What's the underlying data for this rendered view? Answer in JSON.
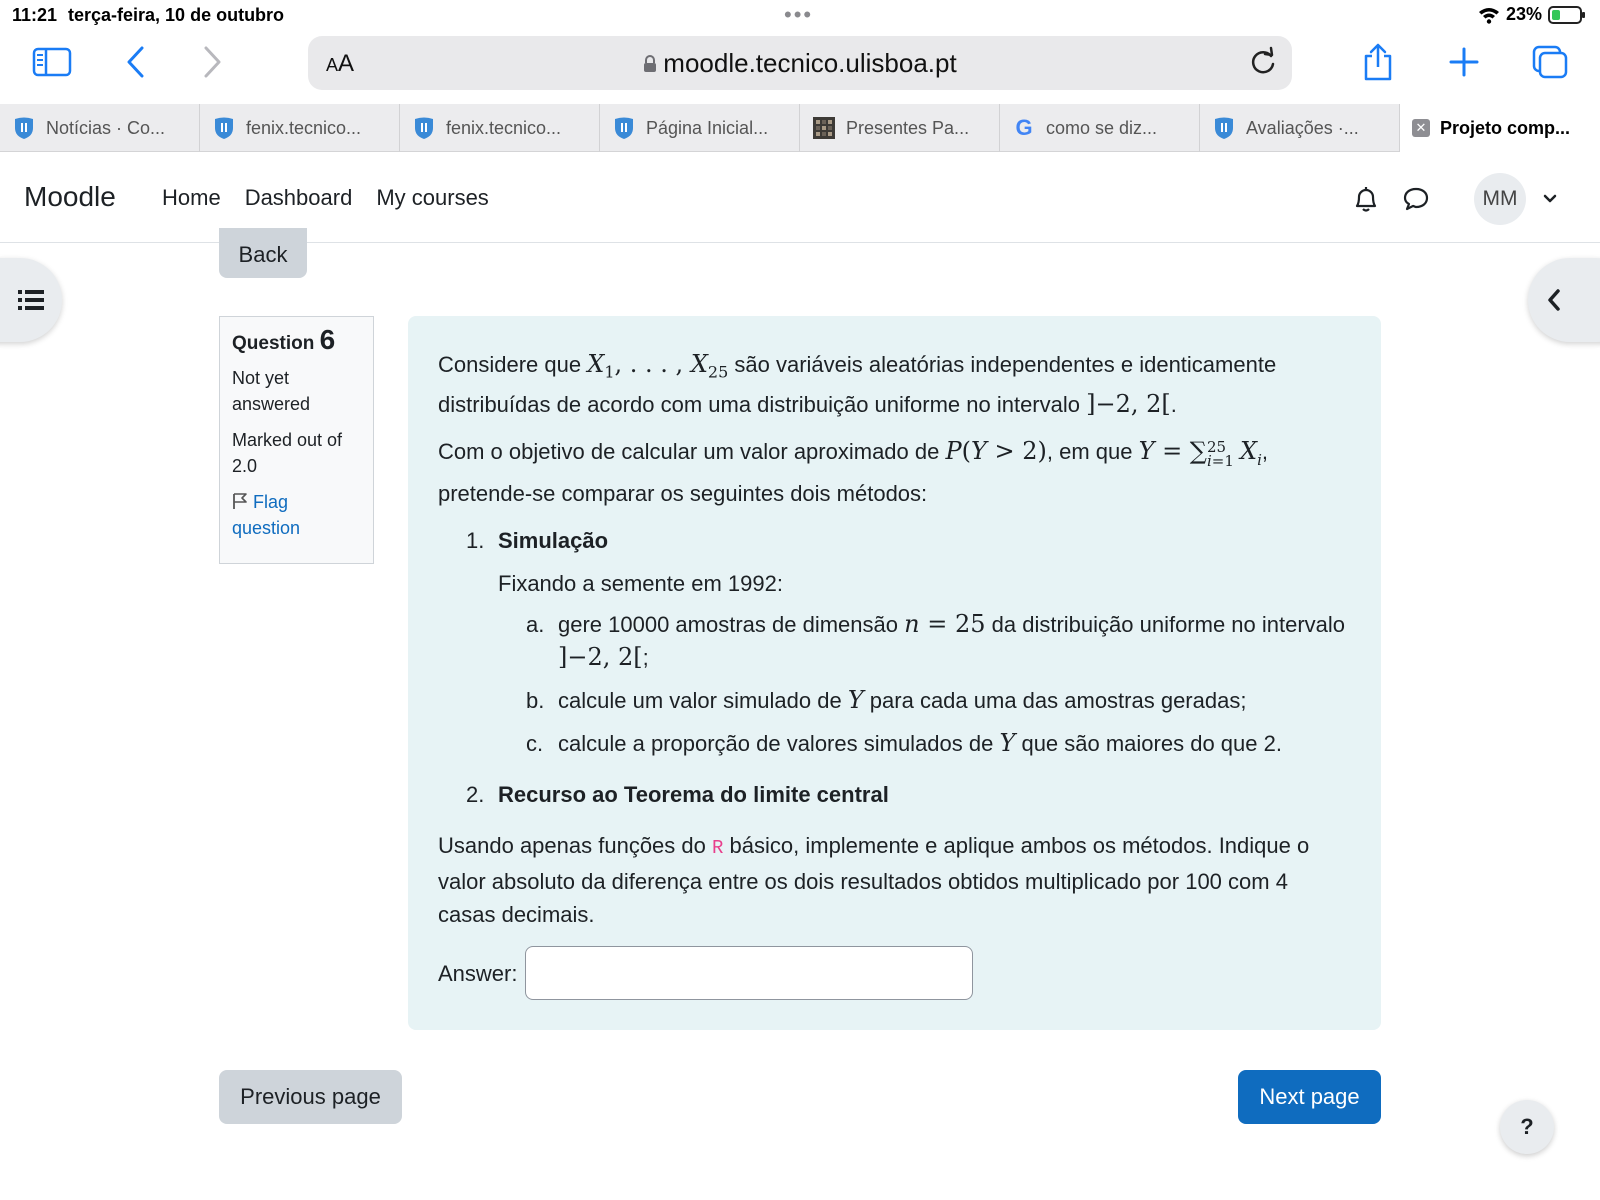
{
  "status_bar": {
    "time": "11:21",
    "date": "terça-feira, 10 de outubro",
    "battery_percent": "23%"
  },
  "browser": {
    "reader_label_small": "A",
    "reader_label_big": "A",
    "url": "moodle.tecnico.ulisboa.pt",
    "tabs": [
      {
        "label": "Notícias · Co...",
        "icon": "ist-shield-icon"
      },
      {
        "label": "fenix.tecnico...",
        "icon": "ist-shield-icon"
      },
      {
        "label": "fenix.tecnico...",
        "icon": "ist-shield-icon"
      },
      {
        "label": "Página Inicial...",
        "icon": "ist-shield-icon"
      },
      {
        "label": "Presentes Pa...",
        "icon": "grid-favicon-icon"
      },
      {
        "label": "como se diz...",
        "icon": "google-icon"
      },
      {
        "label": "Avaliações ·...",
        "icon": "ist-shield-icon"
      },
      {
        "label": "Projeto comp...",
        "icon": "close-icon",
        "active": true
      }
    ]
  },
  "navbar": {
    "brand": "Moodle",
    "links": [
      "Home",
      "Dashboard",
      "My courses"
    ],
    "avatar_initials": "MM"
  },
  "back_label": "Back",
  "question_info": {
    "label": "Question",
    "number": "6",
    "state_line1": "Not yet",
    "state_line2": "answered",
    "grade_line1": "Marked out of",
    "grade_line2": "2.0",
    "flag_line1": "Flag",
    "flag_line2": "question"
  },
  "question": {
    "p1_a": "Considere que",
    "p1_b": "são variáveis aleatórias independentes e identicamente distribuídas de acordo com uma distribuição uniforme no intervalo",
    "p2_a": "Com o objetivo de calcular um valor aproximado de",
    "p2_b": ", em que",
    "p2_c": "pretende-se comparar os seguintes dois métodos:",
    "method1_num": "1.",
    "method1_title": "Simulação",
    "method1_intro": "Fixando a semente em 1992:",
    "step_a_let": "a.",
    "step_a_1": "gere 10000 amostras de dimensão",
    "step_a_2": "da distribuição uniforme no intervalo",
    "step_b_let": "b.",
    "step_b_1": "calcule um valor simulado de",
    "step_b_2": "para cada uma das amostras geradas;",
    "step_c_let": "c.",
    "step_c_1": "calcule a proporção de valores simulados de",
    "step_c_2": "que são maiores do que 2.",
    "method2_num": "2.",
    "method2_title": "Recurso ao Teorema do limite central",
    "p3_a": "Usando apenas funções do",
    "p3_r": "R",
    "p3_b": "básico, implemente e aplique ambos os métodos. Indique o valor absoluto da diferença entre os dois resultados obtidos multiplicado por 100 com 4 casas decimais.",
    "answer_label": "Answer:",
    "answer_value": ""
  },
  "prev_label": "Previous page",
  "next_label": "Next page",
  "help_label": "?"
}
